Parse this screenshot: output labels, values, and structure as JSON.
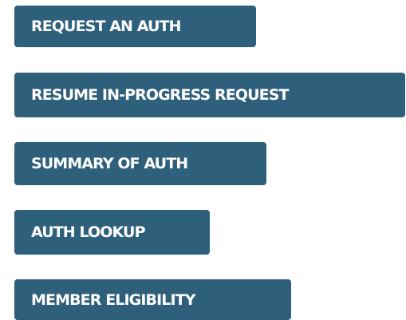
{
  "theme": {
    "button_color": "#2e5f7b",
    "button_text_color": "#ffffff",
    "background": "#ffffff"
  },
  "buttons": [
    {
      "label": "REQUEST AN AUTH"
    },
    {
      "label": "RESUME IN-PROGRESS REQUEST"
    },
    {
      "label": "SUMMARY OF AUTH"
    },
    {
      "label": "AUTH LOOKUP"
    },
    {
      "label": "MEMBER ELIGIBILITY"
    }
  ]
}
